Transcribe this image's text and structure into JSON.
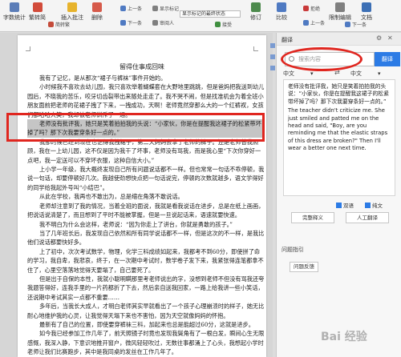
{
  "ribbon": {
    "items": [
      {
        "label": "字数统计",
        "color": "#5b7db8"
      },
      {
        "label": "繁转简",
        "color": "#d24b3a"
      },
      {
        "label": "插入批注",
        "color": "#e7b32c"
      },
      {
        "label": "删除",
        "color": "#d65a4a"
      },
      {
        "label": "修订",
        "color": "#4d8a4d"
      },
      {
        "label": "比较",
        "color": "#4f7ac2"
      },
      {
        "label": "限制编辑",
        "color": "#7f7f7f"
      },
      {
        "label": "文档",
        "color": "#3c6fb5"
      }
    ],
    "small_items": [
      {
        "label": "简转繁",
        "color": "#c44b3a"
      },
      {
        "label": "上一条",
        "color": "#4f7ac2"
      },
      {
        "label": "下一条",
        "color": "#4f7ac2"
      },
      {
        "label": "显示标记",
        "color": "#7f7f7f"
      },
      {
        "label": "审阅人",
        "color": "#7f7f7f"
      },
      {
        "label": "接受",
        "color": "#3f8f3f"
      },
      {
        "label": "拒绝",
        "color": "#c93a3a"
      },
      {
        "label": "上一条",
        "color": "#4f7ac2"
      },
      {
        "label": "下一条",
        "color": "#4f7ac2"
      }
    ],
    "markup_select": "显示标记的最终状态"
  },
  "document": {
    "title": "留得住事成回味",
    "paragraphs": [
      "我有了记忆，是从那次“裙子与裤袜”事件开始的。",
      "小时候我不喜欢去幼儿园，我只喜欢举着蝴蝶套在大野地里跳跳，但是爸妈把我送到幼儿园后，不晓我的苦乐，咬牙切齿裂带出来随处走走了。我不哭不闹，但是找准机会为着全班小朋友面前把老师的花裙子拽了下来，一拽成功，天啊！老师竟然穿那么大的一个红裤衩，女孩们都哈哈大笑，我却被老师训斥了一通。",
      "老师没有批评我，她只是笑着拍拍我的头说：“小家伙，你是在提醒我这裙子的松紧带坏掉了吗？那下次我要穿条好一点的。”",
      "我那时候已经到现在也记得我拽裙子，第二天妈妈去拿了老师的裤子。还是老师替我照顾，我在一上幼儿园，这不仅是因为我干了坏事，老师没有骂我，而是我心里“下次你穿好一点吧，我一定送可以不穿坏衣服，这种自信大小。”",
      "上小学一年级，我大概终发现自己所有问题说话都不一样。但也常常一句话不乖停顿，我说一句话，却要停顿好几次。我越使劲想快点把一句话说完，停顿的次数就越多，语文学得好的同学给我起外号叫“小结巴”。",
      "从此在学校，我再也不敢出为，总是缩在角落不敢说话。",
      "老师却注意到了我的情况，当着全班的面说，我就是看我说话在进步，总是在纸上画画，把说话说清楚了，而且想到了平时不能被掌握，但是一旦说起话来，语速就要快速。",
      "我不明白为什么会这样，老师说：“因为你走上了讲台，你就是勇敢的孩子。”",
      "当了几年班长后，我发现自己依然和所有同学说话都不一样，但是这次的不一样，是我比他们说话都要快好多。",
      "上了初中，次次考试数学，物理，化学三科成绩如起来，我都考不到60分，即使拼了命的学习，我自卑，我悲哀，终于，在一次期中考试时，数学卷子发下来，我紧张得连笔都拿不住了，心里空落落地觉得天要塌了，自己要死了。",
      "但是出于自保的本性，我就小聪明瞒那里考老师说出的字，没想到老师不但没有骂我还夸我题答得好，连我手里的一片药都折了下去，然后亲自送我回家，一路上给我讲一些小笑话，还说期中考试其实一点都不重要……",
      "多年后，当我长大成人，才明白老师其实早就看出了一个孩子心理崩溃时的样子，她无比耐心地维护我的心灵，让我觉得天塌下来也不害怕，因为天空就像妈妈的怀抱。",
      "最新有了自己的位置，即使要穿裤袜三科，加起来也总是能超过60分，这就是进步。",
      "如今我已经参加工作几年了，前天照镜子时竟也发现我鬓角有了一根白发，瞬间心生无限感慨，我深入静，下意识地推开窗户，微风轻轻吹过，无数往事都涌上了心头，我想起小学时老师让我们比赛跑步，其中是我同桌的发丝在工作几年了。"
    ],
    "selection_start": 2
  },
  "translate_pane": {
    "title": "翻译",
    "search_placeholder": "搜索内容",
    "translate_button": "翻译",
    "source_lang": "中文",
    "target_lang": "中文",
    "source_text": "老师没有批评我，她只是笑着拍拍我的头说：“小家伙，你是在提醒我这裙子的松紧带坏掉了吗？那下次我要穿条好一点的。”",
    "translated_text": "The teacher didn't criticize me. She just smiled and patted me on the head and said, \"Boy, are you reminding me that the elastic straps of this dress are broken?\" Then I'll wear a better one next time.",
    "option_bilingual": "双语",
    "option_pure": "纯文",
    "btn_full": "完整释义",
    "btn_human": "人工翻译",
    "section_label": "问题指引",
    "feedback_button": "问题反馈"
  },
  "watermark": "Bai 经验"
}
